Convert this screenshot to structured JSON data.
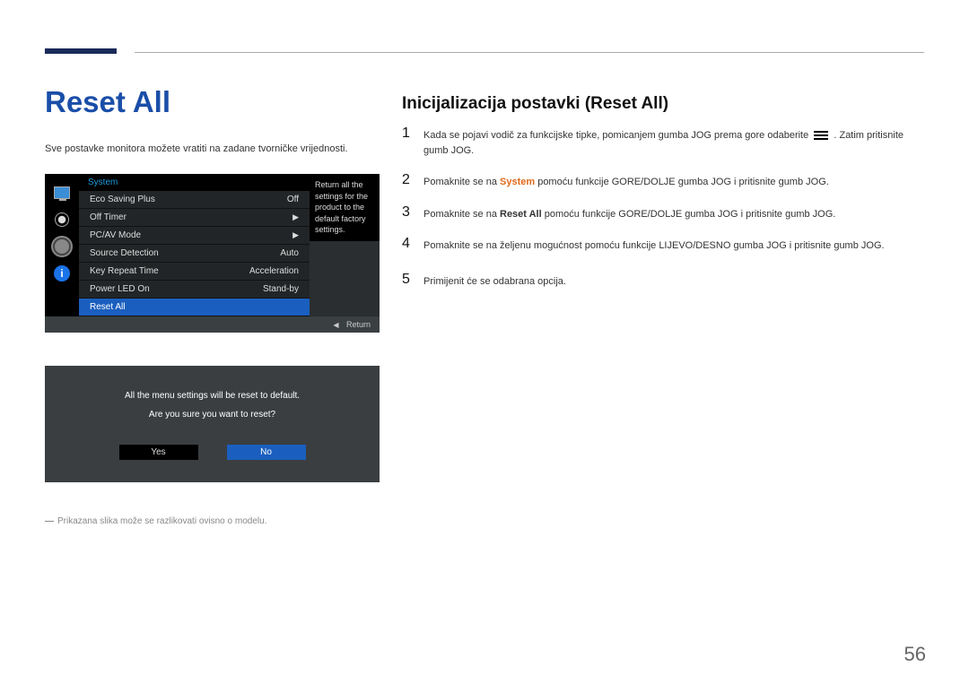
{
  "page": {
    "heading_left": "Reset All",
    "intro": "Sve postavke monitora možete vratiti na zadane tvorničke vrijednosti.",
    "footnote": "Prikazana slika može se razlikovati ovisno o modelu.",
    "page_number": "56",
    "heading_right": "Inicijalizacija postavki (Reset All)"
  },
  "osd": {
    "title": "System",
    "tooltip": "Return all the settings for the product to the default factory settings.",
    "return_label": "Return",
    "items": [
      {
        "label": "Eco Saving Plus",
        "value": "Off"
      },
      {
        "label": "Off Timer",
        "value": "▶"
      },
      {
        "label": "PC/AV Mode",
        "value": "▶"
      },
      {
        "label": "Source Detection",
        "value": "Auto"
      },
      {
        "label": "Key Repeat Time",
        "value": "Acceleration"
      },
      {
        "label": "Power LED On",
        "value": "Stand-by"
      },
      {
        "label": "Reset All",
        "value": ""
      }
    ]
  },
  "confirm": {
    "msg1": "All the menu settings will be reset to default.",
    "msg2": "Are you sure you want to reset?",
    "yes": "Yes",
    "no": "No"
  },
  "steps": {
    "s1a": "Kada se pojavi vodič za funkcijske tipke, pomicanjem gumba JOG prema gore odaberite",
    "s1b": ". Zatim pritisnite gumb JOG.",
    "s2a": "Pomaknite se na ",
    "s2hl": "System",
    "s2b": " pomoću funkcije GORE/DOLJE gumba JOG i pritisnite gumb JOG.",
    "s3a": "Pomaknite se na ",
    "s3hl": "Reset All",
    "s3b": " pomoću funkcije GORE/DOLJE gumba JOG i pritisnite gumb JOG.",
    "s4": "Pomaknite se na željenu mogućnost pomoću funkcije LIJEVO/DESNO gumba JOG i pritisnite gumb JOG.",
    "s5": "Primijenit će se odabrana opcija."
  }
}
